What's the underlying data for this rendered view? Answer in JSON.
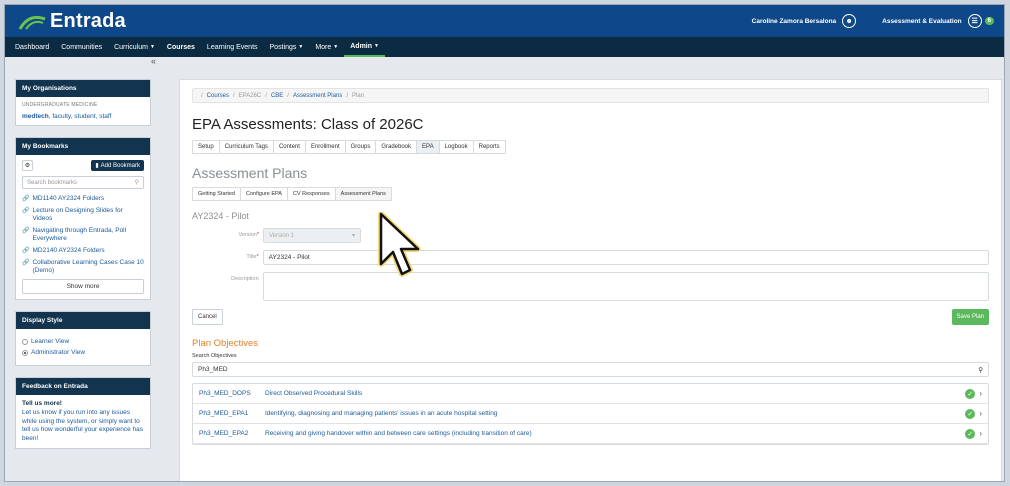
{
  "app": {
    "logo_text": "Entrada",
    "user_name": "Caroline Zamora Bersalona",
    "assessment_label": "Assessment & Evaluation",
    "assessment_badge": "6"
  },
  "nav": [
    {
      "label": "Dashboard",
      "caret": false
    },
    {
      "label": "Communities",
      "caret": false
    },
    {
      "label": "Curriculum",
      "caret": true
    },
    {
      "label": "Courses",
      "caret": false
    },
    {
      "label": "Learning Events",
      "caret": false
    },
    {
      "label": "Postings",
      "caret": true
    },
    {
      "label": "More",
      "caret": true
    },
    {
      "label": "Admin",
      "caret": true
    }
  ],
  "sidebar": {
    "collapse": "«",
    "organisations": {
      "title": "My Organisations",
      "org": "UNDERGRADUATE MEDICINE",
      "role_bold": "medtech",
      "roles": ", faculty, student, staff"
    },
    "bookmarks": {
      "title": "My Bookmarks",
      "add_label": "Add Bookmark",
      "search_placeholder": "Search bookmarks",
      "items": [
        "MD1140 AY2324 Folders",
        "Lecture on Designing Slides for Videos",
        "Navigating through Entrada, Poll Everywhere",
        "MD2140 AY2324 Folders",
        "Collaborative Learning Cases Case 10 (Demo)"
      ],
      "show_more": "Show more"
    },
    "display_style": {
      "title": "Display Style",
      "learner": "Learner View",
      "administrator": "Administrator View"
    },
    "feedback": {
      "title": "Feedback on Entrada",
      "heading": "Tell us more!",
      "text": "Let us know if you run into any issues while using the system, or simply want to tell us how wonderful your experience has been!"
    }
  },
  "main": {
    "breadcrumb": [
      "Courses",
      "EPA26C",
      "CBE",
      "Assessment Plans",
      "Plan"
    ],
    "page_title": "EPA Assessments: Class of 2026C",
    "tabs": [
      "Setup",
      "Curriculum Tags",
      "Content",
      "Enrollment",
      "Groups",
      "Gradebook",
      "EPA",
      "Logbook",
      "Reports"
    ],
    "section_title": "Assessment Plans",
    "subtabs": [
      "Getting Started",
      "Configure EPA",
      "CV Responses",
      "Assessment Plans"
    ],
    "plan_name": "AY2324 - Pilot",
    "form": {
      "version_label": "Version",
      "version_value": "Version 1",
      "title_label": "Title",
      "title_value": "AY2324 - Pilot",
      "description_label": "Description",
      "cancel": "Cancel",
      "save": "Save Plan"
    },
    "objectives": {
      "title": "Plan Objectives",
      "search_label": "Search Objectives",
      "search_value": "Ph3_MED",
      "rows": [
        {
          "code": "Ph3_MED_DOPS",
          "desc": "Direct Observed Procedural Skills"
        },
        {
          "code": "Ph3_MED_EPA1",
          "desc": "Identifying, diagnosing and managing patients' issues in an acute hospital setting"
        },
        {
          "code": "Ph3_MED_EPA2",
          "desc": "Receiving and giving handover within and between care settings (including transition of care)"
        }
      ]
    }
  }
}
